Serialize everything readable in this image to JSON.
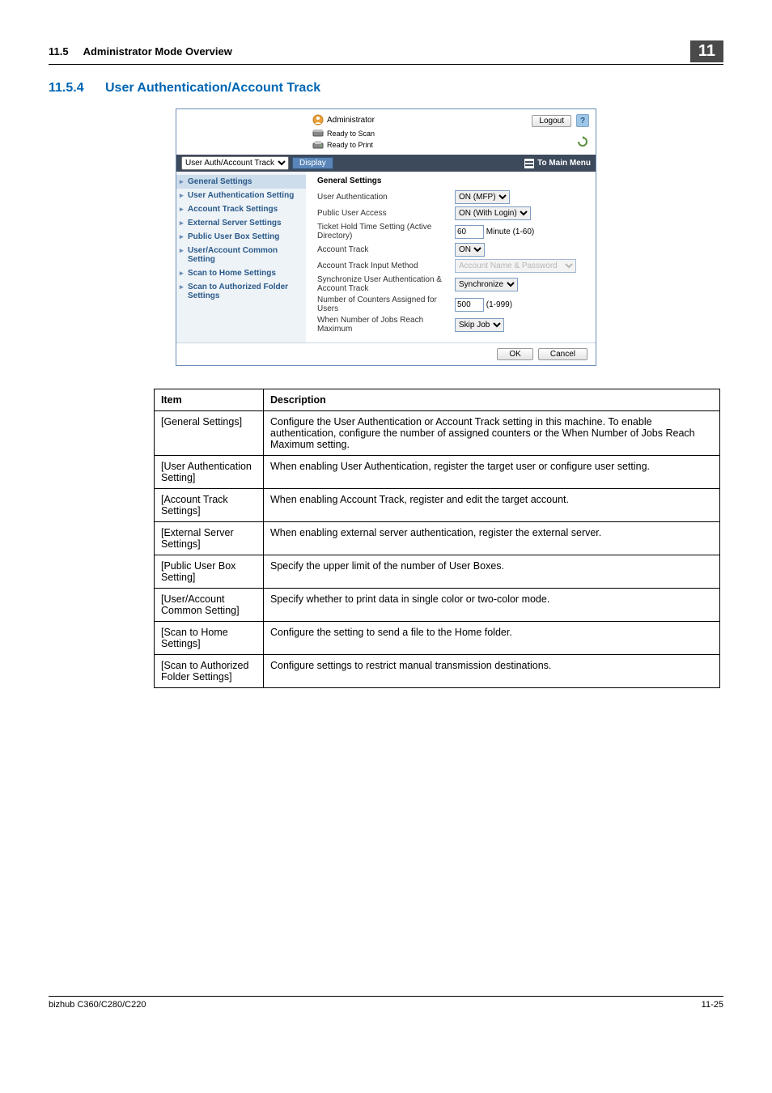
{
  "header": {
    "section_number": "11.5",
    "section_title": "Administrator Mode Overview",
    "chapter_badge": "11"
  },
  "subsection": {
    "number": "11.5.4",
    "title": "User Authentication/Account Track"
  },
  "shot": {
    "admin_label": "Administrator",
    "status_scan": "Ready to Scan",
    "status_print": "Ready to Print",
    "logout": "Logout",
    "help": "?",
    "dropdown_label": "User Auth/Account Track",
    "display_btn": "Display",
    "to_main": "To Main Menu",
    "side_items": [
      "General Settings",
      "User Authentication Setting",
      "Account Track Settings",
      "External Server Settings",
      "Public User Box Setting",
      "User/Account Common Setting",
      "Scan to Home Settings",
      "Scan to Authorized Folder Settings"
    ],
    "form": {
      "title": "General Settings",
      "user_auth_lbl": "User Authentication",
      "user_auth_val": "ON (MFP)",
      "public_access_lbl": "Public User Access",
      "public_access_val": "ON (With Login)",
      "ticket_lbl": "Ticket Hold Time Setting (Active Directory)",
      "ticket_val": "60",
      "ticket_suffix": "Minute (1-60)",
      "acct_track_lbl": "Account Track",
      "acct_track_val": "ON",
      "input_method_lbl": "Account Track Input Method",
      "input_method_val": "Account Name & Password",
      "sync_lbl": "Synchronize User Authentication & Account Track",
      "sync_val": "Synchronize",
      "counters_lbl": "Number of Counters Assigned for Users",
      "counters_val": "500",
      "counters_suffix": "(1-999)",
      "jobs_max_lbl": "When Number of Jobs Reach Maximum",
      "jobs_max_val": "Skip Job"
    },
    "ok_btn": "OK",
    "cancel_btn": "Cancel"
  },
  "table": {
    "head_item": "Item",
    "head_desc": "Description",
    "rows": [
      {
        "item": "[General Settings]",
        "desc": "Configure the User Authentication or Account Track setting in this machine. To enable authentication, configure the number of assigned counters or the When Number of Jobs Reach Maximum setting."
      },
      {
        "item": "[User Authentication Setting]",
        "desc": "When enabling User Authentication, register the target user or configure user setting."
      },
      {
        "item": "[Account Track Settings]",
        "desc": "When enabling Account Track, register and edit the target account."
      },
      {
        "item": "[External Server Settings]",
        "desc": "When enabling external server authentication, register the external server."
      },
      {
        "item": "[Public User Box Setting]",
        "desc": "Specify the upper limit of the number of User Boxes."
      },
      {
        "item": "[User/Account Common Setting]",
        "desc": "Specify whether to print data in single color or two-color mode."
      },
      {
        "item": "[Scan to Home Settings]",
        "desc": "Configure the setting to send a file to the Home folder."
      },
      {
        "item": "[Scan to Authorized Folder Settings]",
        "desc": "Configure settings to restrict manual transmission destinations."
      }
    ]
  },
  "footer": {
    "model": "bizhub C360/C280/C220",
    "page": "11-25"
  }
}
